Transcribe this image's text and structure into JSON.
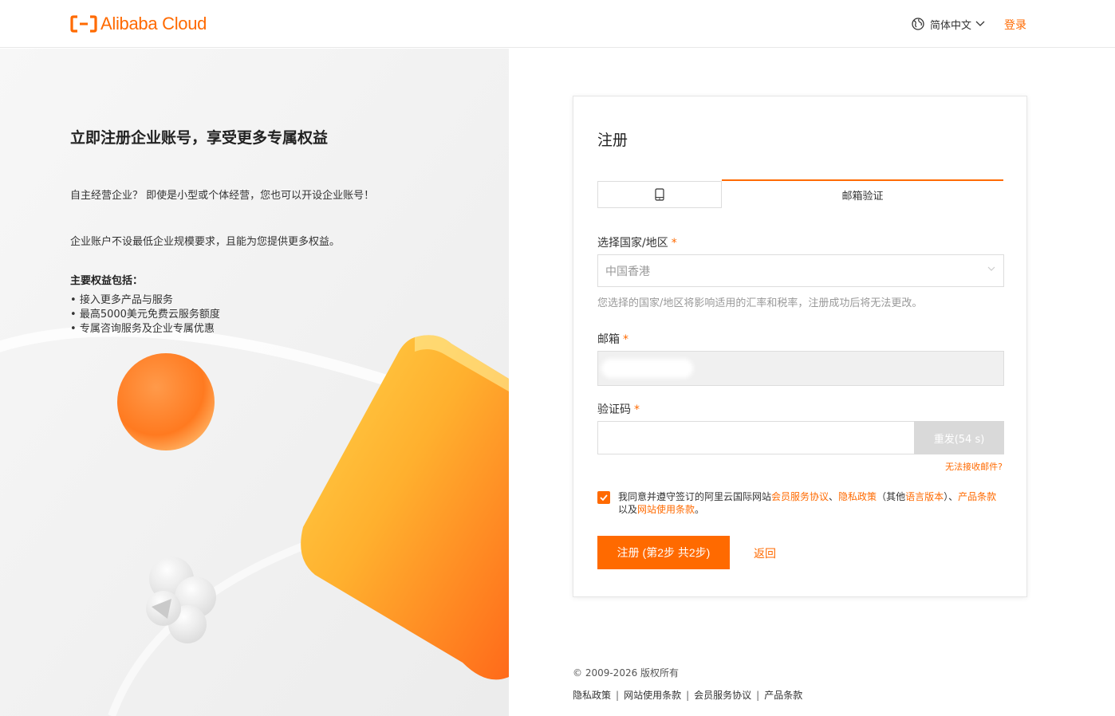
{
  "header": {
    "logo_text": "Alibaba Cloud",
    "language": "简体中文",
    "login": "登录"
  },
  "promo": {
    "title": "立即注册企业账号，享受更多专属权益",
    "paragraph1": "自主经营企业？ 即使是小型或个体经营，您也可以开设企业账号！",
    "paragraph2": "企业账户不设最低企业规模要求，且能为您提供更多权益。",
    "benefits_title": "主要权益包括：",
    "benefits": [
      "接入更多产品与服务",
      "最高5000美元免费云服务额度",
      "专属咨询服务及企业专属优惠"
    ]
  },
  "form": {
    "title": "注册",
    "tabs": {
      "email": "邮箱验证"
    },
    "country_label": "选择国家/地区",
    "country_value": "中国香港",
    "country_hint": "您选择的国家/地区将影响适用的汇率和税率，注册成功后将无法更改。",
    "email_label": "邮箱",
    "code_label": "验证码",
    "resend_label": "重发(54 s)",
    "no_mail_link": "无法接收邮件?",
    "agreement": {
      "prefix": "我同意并遵守签订的阿里云国际网站",
      "link_member": "会员服务协议",
      "sep1": "、",
      "link_privacy": "隐私政策",
      "other_prefix": "（其他",
      "link_lang": "语言版本",
      "other_suffix": "）、",
      "link_product": "产品条款",
      "and": "以及",
      "link_site": "网站使用条款",
      "end": "。"
    },
    "submit": "注册 (第2步 共2步)",
    "back": "返回"
  },
  "footer": {
    "copyright": "© 2009-2026 版权所有",
    "links": [
      "隐私政策",
      "网站使用条款",
      "会员服务协议",
      "产品条款"
    ]
  },
  "colors": {
    "accent": "#ff6a00"
  }
}
